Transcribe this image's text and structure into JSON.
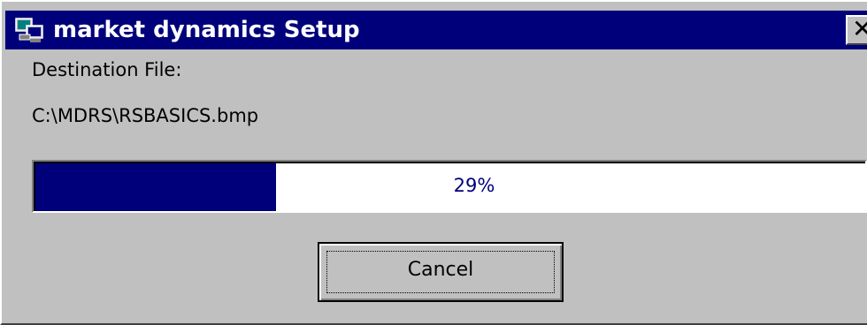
{
  "window": {
    "title": "market dynamics Setup",
    "close_glyph": "✕",
    "icon": "setup-computer-icon"
  },
  "content": {
    "destination_label": "Destination File:",
    "destination_path": "C:\\MDRS\\RSBASICS.bmp"
  },
  "progress": {
    "value": 0.29,
    "text": "29%",
    "fill_color": "#00007b"
  },
  "buttons": {
    "cancel_label": "Cancel"
  },
  "colors": {
    "titlebar": "#00007b",
    "face": "#c0c0c0"
  }
}
